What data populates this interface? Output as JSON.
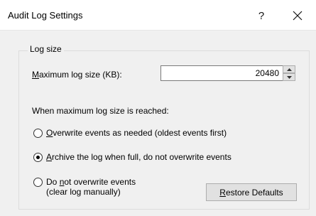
{
  "window": {
    "title": "Audit Log Settings",
    "help_label": "?"
  },
  "group": {
    "legend": "Log size"
  },
  "max_size": {
    "label_mnemonic": "M",
    "label_rest": "aximum log size (KB):",
    "value": "20480"
  },
  "when_full": {
    "label": "When maximum log size is reached:"
  },
  "options": [
    {
      "mnemonic": "O",
      "rest": "verwrite events as needed (oldest events first)",
      "checked": false
    },
    {
      "mnemonic": "A",
      "rest": "rchive the log when full, do not overwrite events",
      "checked": true
    },
    {
      "prefix": "Do ",
      "mnemonic": "n",
      "rest": "ot overwrite events",
      "line2": "(clear log manually)",
      "checked": false
    }
  ],
  "restore_button": {
    "mnemonic": "R",
    "rest": "estore Defaults"
  }
}
